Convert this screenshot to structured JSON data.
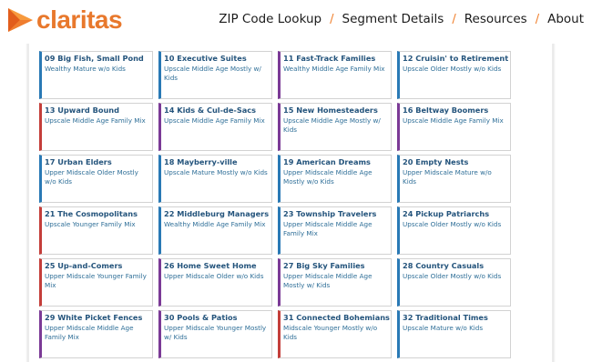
{
  "brand": {
    "name": "claritas",
    "name_color": "#e8782c",
    "logo_icon": "claritas-arrow-logo",
    "logo_colors": [
      "#f79a3e",
      "#e25d1c"
    ]
  },
  "nav": {
    "items": [
      "ZIP Code Lookup",
      "Segment Details",
      "Resources",
      "About"
    ],
    "separator": "/"
  },
  "segment_colors": {
    "blue": "#2979b5",
    "purple": "#7b3a96",
    "red": "#c43e3a"
  },
  "segments": [
    {
      "title": "09 Big Fish, Small Pond",
      "subtitle": "Wealthy Mature w/o Kids",
      "accent": "blue"
    },
    {
      "title": "10 Executive Suites",
      "subtitle": "Upscale Middle Age Mostly w/ Kids",
      "accent": "blue"
    },
    {
      "title": "11 Fast-Track Families",
      "subtitle": "Wealthy Middle Age Family Mix",
      "accent": "purple"
    },
    {
      "title": "12 Cruisin' to Retirement",
      "subtitle": "Upscale Older Mostly w/o Kids",
      "accent": "blue"
    },
    {
      "title": "13 Upward Bound",
      "subtitle": "Upscale Middle Age Family Mix",
      "accent": "red"
    },
    {
      "title": "14 Kids & Cul-de-Sacs",
      "subtitle": "Upscale Middle Age Family Mix",
      "accent": "purple"
    },
    {
      "title": "15 New Homesteaders",
      "subtitle": "Upscale Middle Age Mostly w/ Kids",
      "accent": "purple"
    },
    {
      "title": "16 Beltway Boomers",
      "subtitle": "Upscale Middle Age Family Mix",
      "accent": "purple"
    },
    {
      "title": "17 Urban Elders",
      "subtitle": "Upper Midscale Older Mostly w/o Kids",
      "accent": "blue"
    },
    {
      "title": "18 Mayberry-ville",
      "subtitle": "Upscale Mature Mostly w/o Kids",
      "accent": "blue"
    },
    {
      "title": "19 American Dreams",
      "subtitle": "Upper Midscale Middle Age Mostly w/o Kids",
      "accent": "blue"
    },
    {
      "title": "20 Empty Nests",
      "subtitle": "Upper Midscale Mature w/o Kids",
      "accent": "blue"
    },
    {
      "title": "21 The Cosmopolitans",
      "subtitle": "Upscale Younger Family Mix",
      "accent": "red"
    },
    {
      "title": "22 Middleburg Managers",
      "subtitle": "Wealthy Middle Age Family Mix",
      "accent": "blue"
    },
    {
      "title": "23 Township Travelers",
      "subtitle": "Upper Midscale Middle Age Family Mix",
      "accent": "blue"
    },
    {
      "title": "24 Pickup Patriarchs",
      "subtitle": "Upscale Older Mostly w/o Kids",
      "accent": "blue"
    },
    {
      "title": "25 Up-and-Comers",
      "subtitle": "Upper Midscale Younger Family Mix",
      "accent": "red"
    },
    {
      "title": "26 Home Sweet Home",
      "subtitle": "Upper Midscale Older w/o Kids",
      "accent": "purple"
    },
    {
      "title": "27 Big Sky Families",
      "subtitle": "Upper Midscale Middle Age Mostly w/ Kids",
      "accent": "purple"
    },
    {
      "title": "28 Country Casuals",
      "subtitle": "Upscale Older Mostly w/o Kids",
      "accent": "blue"
    },
    {
      "title": "29 White Picket Fences",
      "subtitle": "Upper Midscale Middle Age Family Mix",
      "accent": "purple"
    },
    {
      "title": "30 Pools & Patios",
      "subtitle": "Upper Midscale Younger Mostly w/ Kids",
      "accent": "purple"
    },
    {
      "title": "31 Connected Bohemians",
      "subtitle": "Midscale Younger Mostly w/o Kids",
      "accent": "red"
    },
    {
      "title": "32 Traditional Times",
      "subtitle": "Upscale Mature w/o Kids",
      "accent": "blue"
    }
  ]
}
